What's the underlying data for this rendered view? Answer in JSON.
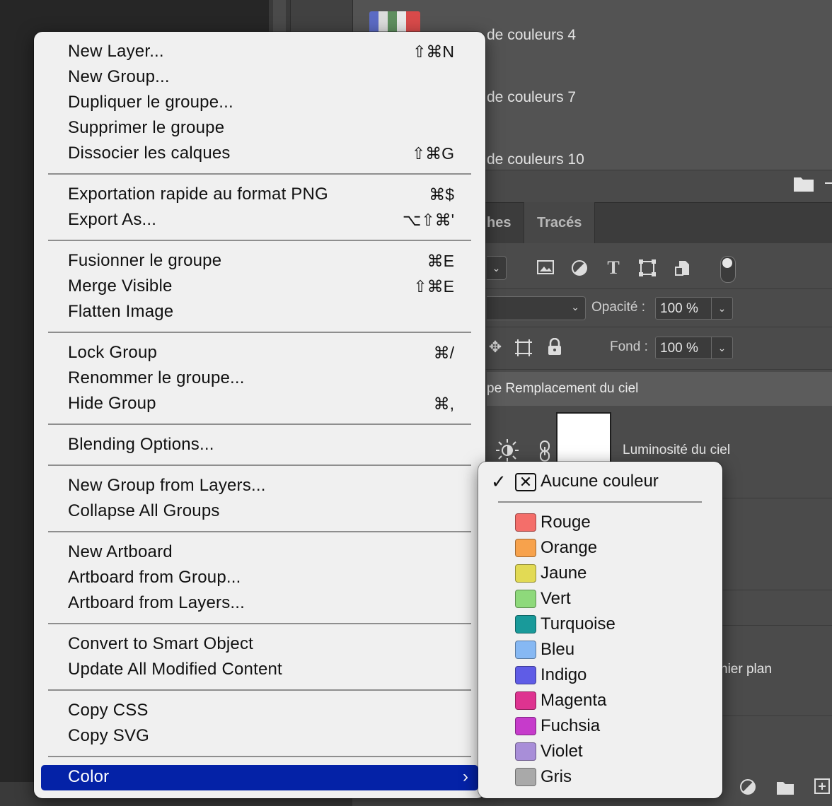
{
  "background": {
    "swatch_groups": [
      {
        "label": "de couleurs 4"
      },
      {
        "label": "de couleurs 7"
      },
      {
        "label": "de couleurs 10"
      }
    ],
    "tabs": [
      {
        "label": "hes"
      },
      {
        "label": "Tracés"
      }
    ],
    "opacity": {
      "label": "Opacité :",
      "value": "100 %"
    },
    "fill": {
      "label": "Fond :",
      "value": "100 %"
    },
    "group_row_label": "pe Remplacement du ciel",
    "layer_label": "Luminosité du ciel",
    "partial_layer_label": "nier plan"
  },
  "menu": {
    "groups": [
      [
        {
          "label": "New Layer...",
          "shortcut": "⇧⌘N"
        },
        {
          "label": "New Group...",
          "shortcut": ""
        },
        {
          "label": "Dupliquer le groupe...",
          "shortcut": ""
        },
        {
          "label": "Supprimer le groupe",
          "shortcut": ""
        },
        {
          "label": "Dissocier les calques",
          "shortcut": "⇧⌘G"
        }
      ],
      [
        {
          "label": "Exportation rapide au format PNG",
          "shortcut": "⌘$"
        },
        {
          "label": "Export As...",
          "shortcut": "⌥⇧⌘'"
        }
      ],
      [
        {
          "label": "Fusionner le groupe",
          "shortcut": "⌘E"
        },
        {
          "label": "Merge Visible",
          "shortcut": "⇧⌘E"
        },
        {
          "label": "Flatten Image",
          "shortcut": ""
        }
      ],
      [
        {
          "label": "Lock Group",
          "shortcut": "⌘/"
        },
        {
          "label": "Renommer le groupe...",
          "shortcut": ""
        },
        {
          "label": "Hide Group",
          "shortcut": "⌘,"
        }
      ],
      [
        {
          "label": "Blending Options...",
          "shortcut": ""
        }
      ],
      [
        {
          "label": "New Group from Layers...",
          "shortcut": ""
        },
        {
          "label": "Collapse All Groups",
          "shortcut": ""
        }
      ],
      [
        {
          "label": "New Artboard",
          "shortcut": ""
        },
        {
          "label": "Artboard from Group...",
          "shortcut": ""
        },
        {
          "label": "Artboard from Layers...",
          "shortcut": ""
        }
      ],
      [
        {
          "label": "Convert to Smart Object",
          "shortcut": ""
        },
        {
          "label": "Update All Modified Content",
          "shortcut": ""
        }
      ],
      [
        {
          "label": "Copy CSS",
          "shortcut": ""
        },
        {
          "label": "Copy SVG",
          "shortcut": ""
        }
      ]
    ],
    "highlighted": {
      "label": "Color"
    }
  },
  "color_submenu": {
    "selected": {
      "label": "Aucune couleur"
    },
    "items": [
      {
        "label": "Rouge",
        "color": "#f46e6a"
      },
      {
        "label": "Orange",
        "color": "#f7a24c"
      },
      {
        "label": "Jaune",
        "color": "#e2da54"
      },
      {
        "label": "Vert",
        "color": "#8ed97b"
      },
      {
        "label": "Turquoise",
        "color": "#199a9a"
      },
      {
        "label": "Bleu",
        "color": "#86b8f3"
      },
      {
        "label": "Indigo",
        "color": "#5f5ce6"
      },
      {
        "label": "Magenta",
        "color": "#de3390"
      },
      {
        "label": "Fuchsia",
        "color": "#c63bcb"
      },
      {
        "label": "Violet",
        "color": "#a88ed8"
      },
      {
        "label": "Gris",
        "color": "#a9a9a9"
      }
    ]
  }
}
